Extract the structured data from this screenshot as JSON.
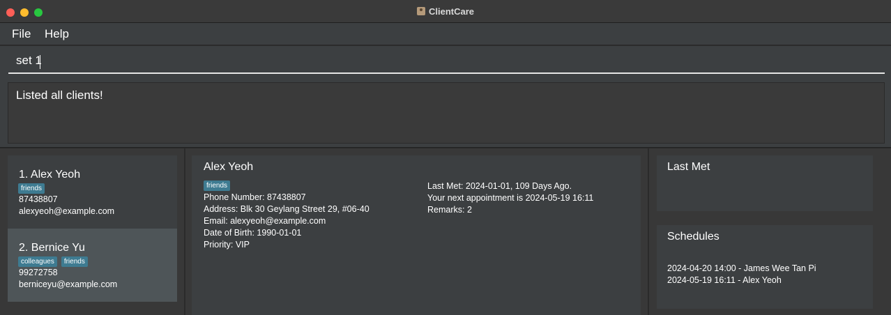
{
  "window": {
    "title": "ClientCare"
  },
  "menu": {
    "file": "File",
    "help": "Help"
  },
  "command": {
    "value": "set 1"
  },
  "result": {
    "message": "Listed all clients!"
  },
  "clients": [
    {
      "index_name": "1.  Alex Yeoh",
      "tags": [
        "friends"
      ],
      "phone": "87438807",
      "email": "alexyeoh@example.com"
    },
    {
      "index_name": "2.  Bernice Yu",
      "tags": [
        "colleagues",
        "friends"
      ],
      "phone": "99272758",
      "email": "berniceyu@example.com"
    }
  ],
  "detail": {
    "name": "Alex Yeoh",
    "tags": [
      "friends"
    ],
    "phone": "Phone Number: 87438807",
    "address": "Address: Blk 30 Geylang Street 29, #06-40",
    "email": "Email: alexyeoh@example.com",
    "dob": "Date of Birth: 1990-01-01",
    "priority": "Priority: VIP",
    "last_met": "Last Met: 2024-01-01, 109 Days Ago.",
    "next_appointment": "Your next appointment is 2024-05-19 16:11",
    "remarks": "Remarks: 2"
  },
  "side": {
    "last_met_title": "Last Met",
    "schedules_title": "Schedules",
    "schedules": [
      "2024-04-20 14:00 - James Wee Tan Pi",
      "2024-05-19 16:11 - Alex Yeoh"
    ]
  },
  "colors": {
    "tag": "#3e7b91",
    "selected_card": "#4e5558",
    "panel": "#3c3f41"
  }
}
